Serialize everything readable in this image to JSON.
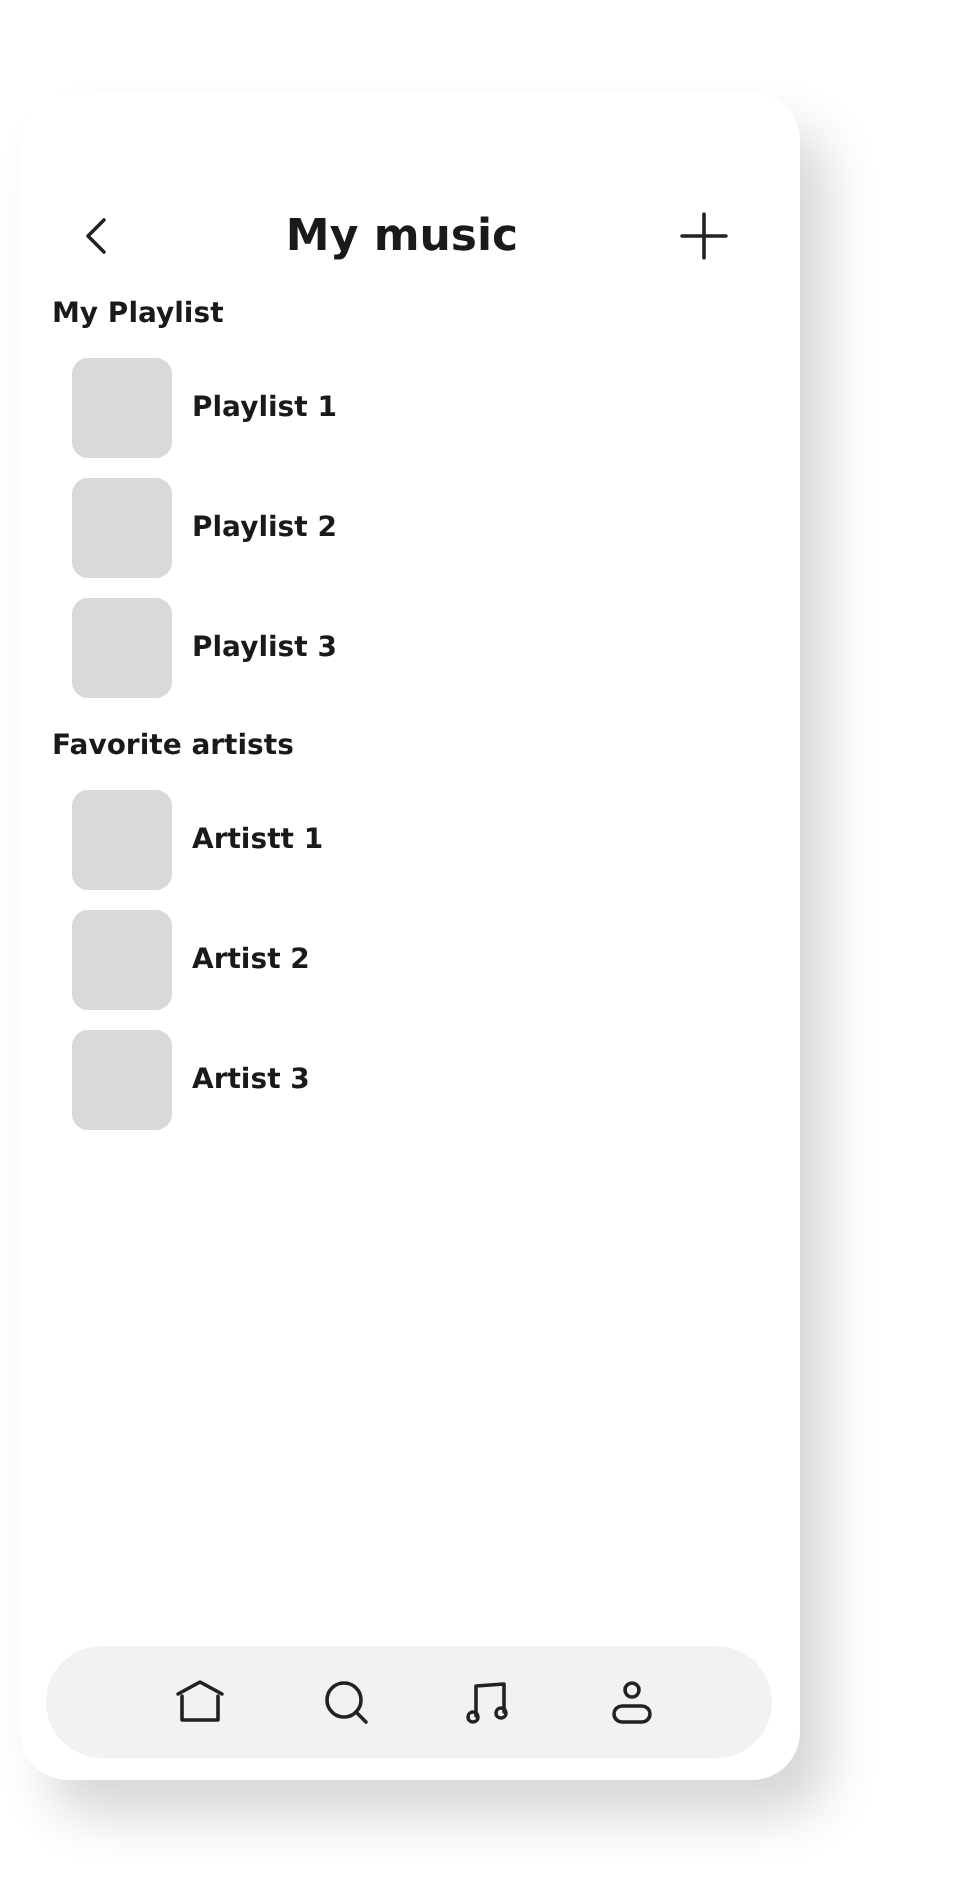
{
  "header": {
    "title": "My music"
  },
  "sections": [
    {
      "title": "My Playlist",
      "items": [
        {
          "label": "Playlist 1"
        },
        {
          "label": "Playlist 2"
        },
        {
          "label": "Playlist 3"
        }
      ]
    },
    {
      "title": "Favorite artists",
      "items": [
        {
          "label": "Artistt 1"
        },
        {
          "label": "Artist 2"
        },
        {
          "label": "Artist 3"
        }
      ]
    }
  ],
  "nav": [
    {
      "kind": "home"
    },
    {
      "kind": "search"
    },
    {
      "kind": "music"
    },
    {
      "kind": "profile"
    }
  ]
}
